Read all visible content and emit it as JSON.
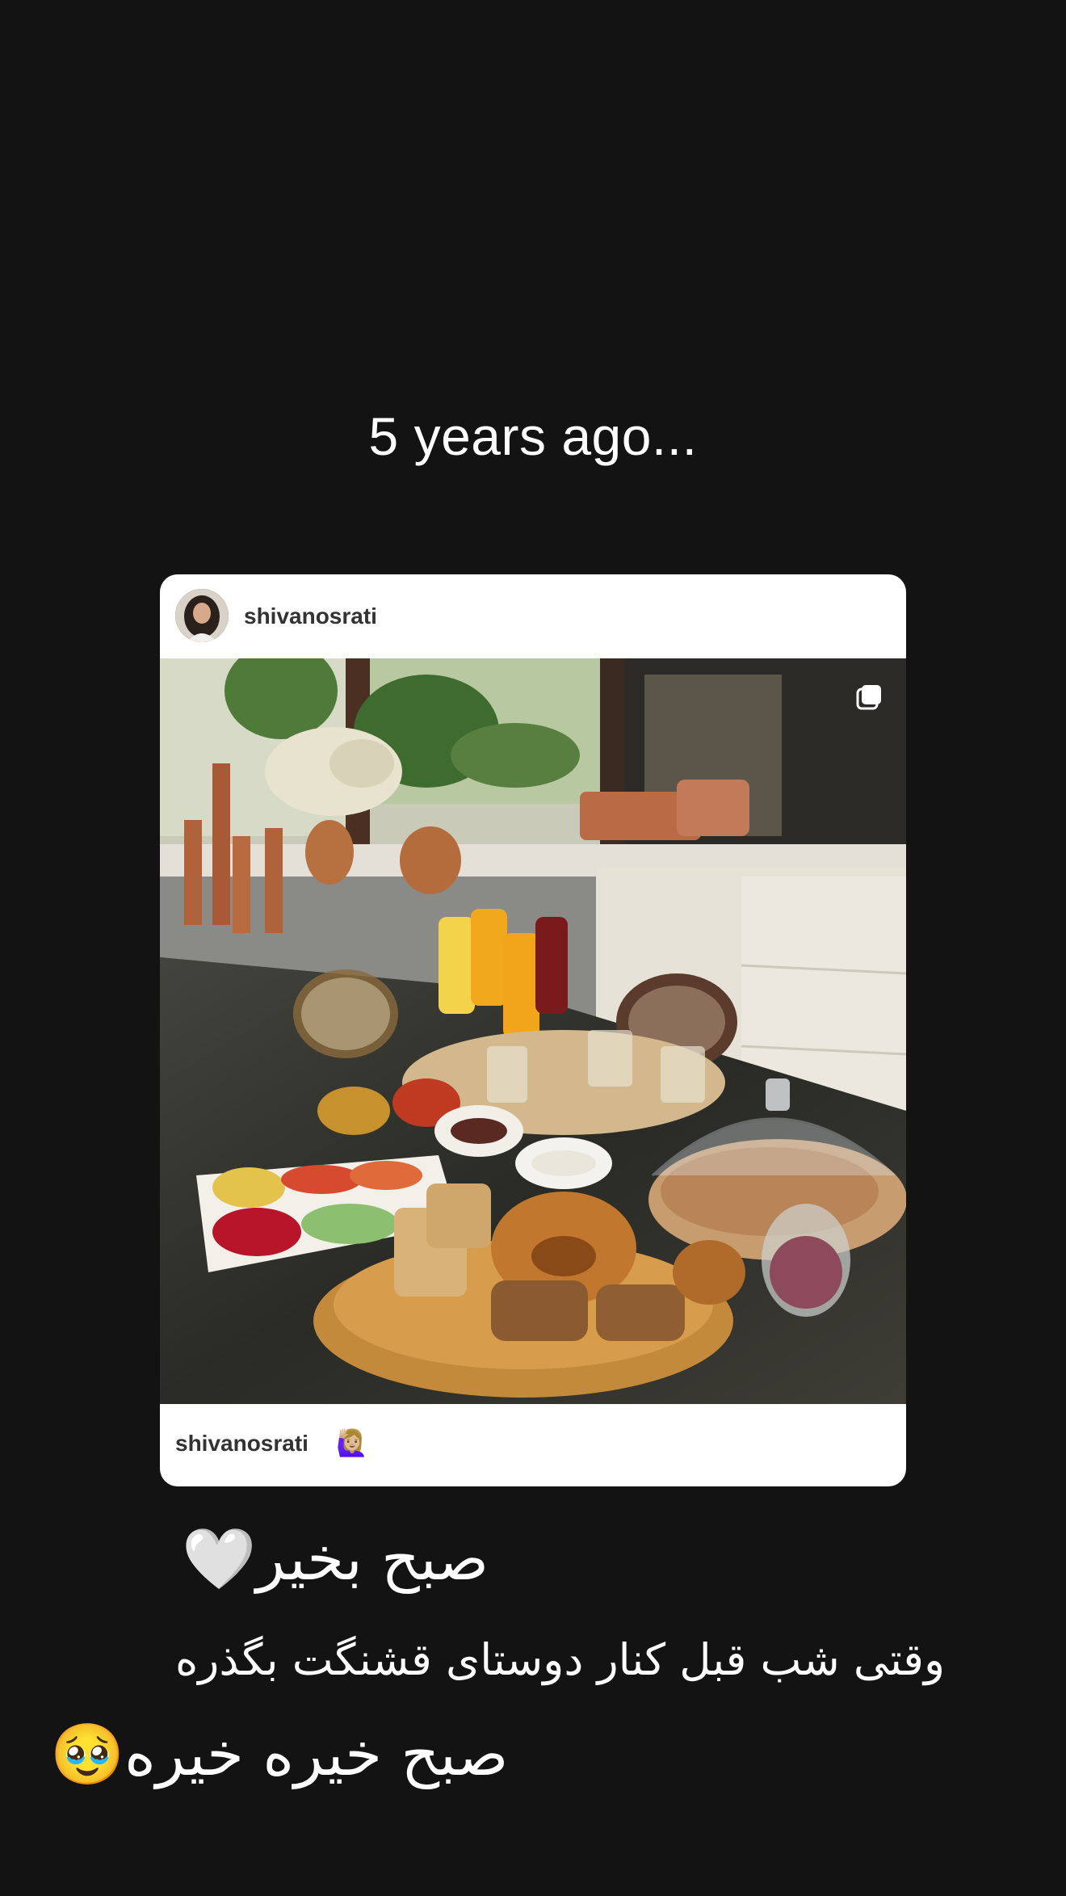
{
  "memory": {
    "title": "5 years ago..."
  },
  "post": {
    "username": "shivanosrati",
    "avatar_icon": "profile-photo",
    "multi_photo_icon": "carousel-icon",
    "footer": {
      "username": "shivanosrati",
      "emoji": "🙋🏼‍♀️"
    }
  },
  "caption": {
    "line1": "صبح بخیر🤍",
    "line2": "وقتی شب قبل کنار دوستای قشنگت بگذره",
    "line3": "صبح خیره خیره🥹"
  },
  "colors": {
    "background": "#131313",
    "card": "#ffffff",
    "text": "#ffffff"
  }
}
